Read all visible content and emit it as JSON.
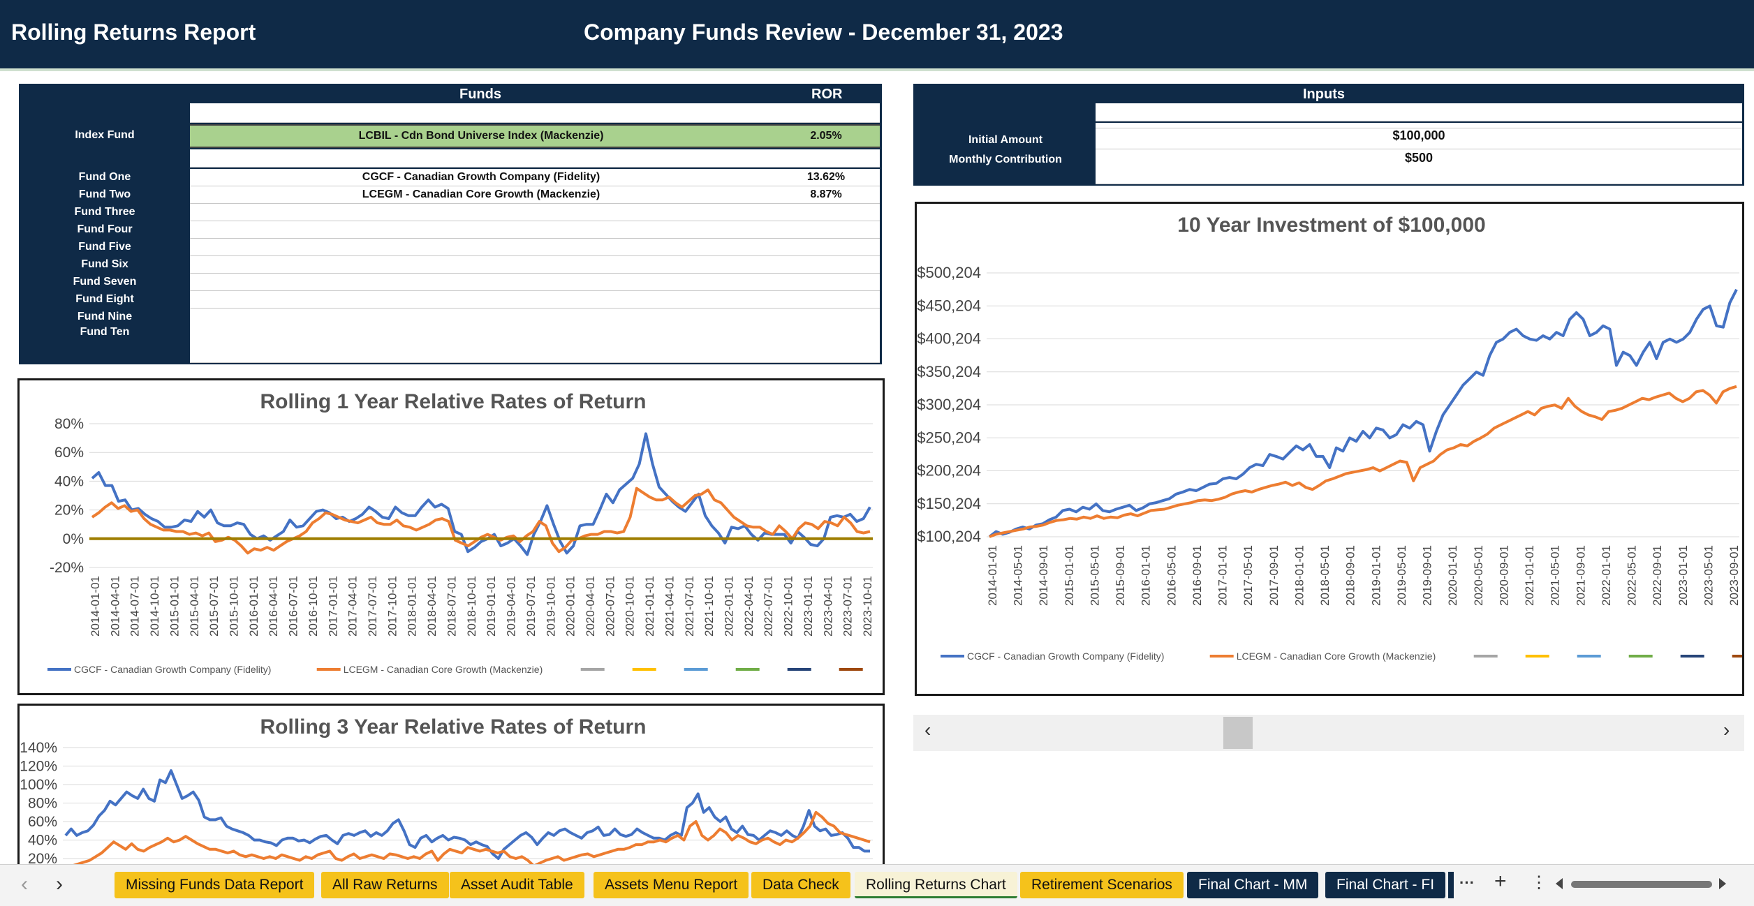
{
  "header": {
    "left_title": "Rolling Returns Report",
    "center_title": "Company Funds Review - December 31, 2023"
  },
  "funds_table": {
    "col_funds": "Funds",
    "col_ror": "ROR",
    "index_label": "Index Fund",
    "index_fund": "LCBIL - Cdn Bond Universe Index (Mackenzie)",
    "index_ror": "2.05%",
    "rows": [
      {
        "label": "Fund One",
        "fund": "CGCF - Canadian Growth Company (Fidelity)",
        "ror": "13.62%"
      },
      {
        "label": "Fund Two",
        "fund": "LCEGM - Canadian Core Growth (Mackenzie)",
        "ror": "8.87%"
      },
      {
        "label": "Fund Three",
        "fund": "",
        "ror": ""
      },
      {
        "label": "Fund Four",
        "fund": "",
        "ror": ""
      },
      {
        "label": "Fund Five",
        "fund": "",
        "ror": ""
      },
      {
        "label": "Fund Six",
        "fund": "",
        "ror": ""
      },
      {
        "label": "Fund Seven",
        "fund": "",
        "ror": ""
      },
      {
        "label": "Fund Eight",
        "fund": "",
        "ror": ""
      },
      {
        "label": "Fund Nine",
        "fund": "",
        "ror": ""
      },
      {
        "label": "Fund Ten",
        "fund": "",
        "ror": ""
      }
    ]
  },
  "inputs": {
    "title": "Inputs",
    "initial_label": "Initial Amount",
    "initial_value": "$100,000",
    "monthly_label": "Monthly Contribution",
    "monthly_value": "$500"
  },
  "colors": {
    "navy": "#0f2a47",
    "fund_one": "#4472c4",
    "fund_two": "#ed7d31",
    "index_green": "#a9d18e",
    "tab_yellow": "#f5c21b"
  },
  "chart_data": [
    {
      "type": "line",
      "title": "Rolling 1 Year Relative Rates of Return",
      "y_ticks": [
        "80%",
        "60%",
        "40%",
        "20%",
        "0%",
        "-20%"
      ],
      "ylim": [
        -20,
        80
      ],
      "x_ticks": [
        "2014-01-01",
        "2014-04-01",
        "2014-07-01",
        "2014-10-01",
        "2015-01-01",
        "2015-04-01",
        "2015-07-01",
        "2015-10-01",
        "2016-01-01",
        "2016-04-01",
        "2016-07-01",
        "2016-10-01",
        "2017-01-01",
        "2017-04-01",
        "2017-07-01",
        "2017-10-01",
        "2018-01-01",
        "2018-04-01",
        "2018-07-01",
        "2018-10-01",
        "2019-01-01",
        "2019-04-01",
        "2019-07-01",
        "2019-10-01",
        "2020-01-01",
        "2020-04-01",
        "2020-07-01",
        "2020-10-01",
        "2021-01-01",
        "2021-04-01",
        "2021-07-01",
        "2021-10-01",
        "2022-01-01",
        "2022-04-01",
        "2022-07-01",
        "2022-10-01",
        "2023-01-01",
        "2023-04-01",
        "2023-07-01",
        "2023-10-01"
      ],
      "legend": [
        "CGCF - Canadian Growth Company (Fidelity)",
        "LCEGM - Canadian Core Growth (Mackenzie)"
      ],
      "series": [
        {
          "name": "CGCF - Canadian Growth Company (Fidelity)",
          "color": "#4472c4",
          "values": [
            42,
            46,
            37,
            37,
            26,
            27,
            20,
            21,
            17,
            14,
            12,
            8,
            8,
            9,
            13,
            12,
            19,
            15,
            20,
            11,
            9,
            9,
            11,
            10,
            3,
            0,
            2,
            -1,
            2,
            5,
            13,
            8,
            9,
            14,
            19,
            20,
            18,
            14,
            15,
            12,
            14,
            17,
            22,
            19,
            15,
            14,
            22,
            18,
            16,
            16,
            22,
            27,
            22,
            24,
            21,
            5,
            3,
            -9,
            -6,
            -2,
            0,
            3,
            -5,
            -3,
            0,
            -5,
            -11,
            3,
            12,
            23,
            10,
            -2,
            -10,
            -5,
            9,
            10,
            10,
            20,
            31,
            25,
            34,
            38,
            42,
            52,
            73,
            52,
            36,
            31,
            26,
            22,
            19,
            25,
            31,
            16,
            9,
            4,
            -3,
            8,
            7,
            9,
            3,
            -1,
            4,
            3,
            3,
            3,
            -3,
            5,
            1,
            -4,
            -5,
            0,
            15,
            16,
            15,
            17,
            12,
            14,
            22
          ]
        },
        {
          "name": "LCEGM - Canadian Core Growth (Mackenzie)",
          "color": "#ed7d31",
          "values": [
            15,
            18,
            22,
            25,
            21,
            23,
            19,
            20,
            14,
            10,
            8,
            6,
            6,
            5,
            5,
            3,
            4,
            2,
            4,
            -2,
            -1,
            1,
            -1,
            -5,
            -10,
            -7,
            -8,
            -6,
            -8,
            -5,
            -2,
            0,
            2,
            5,
            11,
            14,
            18,
            17,
            15,
            13,
            12,
            11,
            13,
            15,
            11,
            10,
            10,
            13,
            9,
            8,
            6,
            8,
            10,
            13,
            14,
            12,
            -1,
            -3,
            -5,
            -2,
            1,
            3,
            1,
            -1,
            1,
            2,
            -2,
            2,
            5,
            12,
            9,
            -3,
            -9,
            -6,
            -1,
            0,
            2,
            3,
            3,
            5,
            5,
            4,
            5,
            15,
            35,
            32,
            29,
            27,
            27,
            29,
            25,
            22,
            26,
            30,
            31,
            34,
            27,
            25,
            20,
            15,
            12,
            9,
            8,
            8,
            5,
            3,
            9,
            5,
            0,
            7,
            11,
            10,
            7,
            12,
            11,
            9,
            15,
            11,
            5,
            4,
            5
          ]
        },
        {
          "name": "",
          "color": "#9e7d00",
          "values": [
            0
          ]
        }
      ]
    },
    {
      "type": "line",
      "title": "10 Year Investment of $100,000",
      "y_ticks": [
        "$500,204",
        "$450,204",
        "$400,204",
        "$350,204",
        "$300,204",
        "$250,204",
        "$200,204",
        "$150,204",
        "$100,204"
      ],
      "ylim": [
        100204,
        500204
      ],
      "x_ticks": [
        "2014-01-01",
        "2014-05-01",
        "2014-09-01",
        "2015-01-01",
        "2015-05-01",
        "2015-09-01",
        "2016-01-01",
        "2016-05-01",
        "2016-09-01",
        "2017-01-01",
        "2017-05-01",
        "2017-09-01",
        "2018-01-01",
        "2018-05-01",
        "2018-09-01",
        "2019-01-01",
        "2019-05-01",
        "2019-09-01",
        "2020-01-01",
        "2020-05-01",
        "2020-09-01",
        "2021-01-01",
        "2021-05-01",
        "2021-09-01",
        "2022-01-01",
        "2022-05-01",
        "2022-09-01",
        "2023-01-01",
        "2023-05-01",
        "2023-09-01"
      ],
      "legend": [
        "CGCF - Canadian Growth Company (Fidelity)",
        "LCEGM - Canadian Core Growth (Mackenzie)"
      ],
      "series": [
        {
          "name": "CGCF - Canadian Growth Company (Fidelity)",
          "color": "#4472c4",
          "values": [
            100204,
            108000,
            104000,
            107000,
            112000,
            115000,
            112000,
            118000,
            120000,
            126000,
            130000,
            140000,
            142000,
            138000,
            145000,
            142000,
            150000,
            140000,
            138000,
            142000,
            145000,
            148000,
            140000,
            144000,
            150000,
            152000,
            155000,
            158000,
            165000,
            168000,
            172000,
            170000,
            175000,
            180000,
            181000,
            188000,
            190000,
            188000,
            195000,
            205000,
            210000,
            208000,
            225000,
            222000,
            218000,
            228000,
            238000,
            232000,
            240000,
            222000,
            222000,
            205000,
            235000,
            230000,
            250000,
            245000,
            260000,
            250000,
            265000,
            262000,
            250000,
            255000,
            270000,
            265000,
            275000,
            270000,
            230000,
            260000,
            285000,
            300000,
            315000,
            330000,
            340000,
            350000,
            345000,
            375000,
            395000,
            400000,
            410000,
            415000,
            405000,
            400000,
            398000,
            405000,
            400000,
            410000,
            405000,
            430000,
            440000,
            430000,
            405000,
            410000,
            420000,
            415000,
            360000,
            380000,
            375000,
            360000,
            380000,
            395000,
            370000,
            395000,
            400000,
            395000,
            400000,
            410000,
            430000,
            445000,
            450000,
            420000,
            418000,
            455000,
            475000
          ]
        },
        {
          "name": "LCEGM - Canadian Core Growth (Mackenzie)",
          "color": "#ed7d31",
          "values": [
            100204,
            104000,
            106000,
            108000,
            110000,
            112000,
            115000,
            116000,
            118000,
            122000,
            125000,
            126000,
            128000,
            127000,
            130000,
            128000,
            132000,
            128000,
            130000,
            129000,
            133000,
            135000,
            132000,
            136000,
            140000,
            141000,
            142000,
            145000,
            148000,
            150000,
            152000,
            155000,
            156000,
            155000,
            157000,
            160000,
            165000,
            168000,
            170000,
            168000,
            172000,
            175000,
            178000,
            180000,
            183000,
            178000,
            182000,
            175000,
            172000,
            178000,
            185000,
            188000,
            192000,
            196000,
            198000,
            200000,
            202000,
            205000,
            200000,
            205000,
            210000,
            215000,
            213000,
            185000,
            205000,
            210000,
            215000,
            225000,
            232000,
            235000,
            240000,
            238000,
            245000,
            250000,
            256000,
            265000,
            270000,
            275000,
            280000,
            285000,
            290000,
            285000,
            295000,
            298000,
            300000,
            295000,
            310000,
            298000,
            290000,
            285000,
            282000,
            278000,
            290000,
            292000,
            295000,
            300000,
            305000,
            310000,
            308000,
            312000,
            315000,
            318000,
            310000,
            305000,
            310000,
            320000,
            322000,
            315000,
            303000,
            320000,
            325000,
            328000
          ]
        }
      ]
    },
    {
      "type": "line",
      "title": "Rolling 3 Year Relative Rates of Return",
      "y_ticks": [
        "140%",
        "120%",
        "100%",
        "80%",
        "60%",
        "40%",
        "20%"
      ],
      "ylim": [
        20,
        140
      ],
      "series": [
        {
          "name": "CGCF - Canadian Growth Company (Fidelity)",
          "color": "#4472c4",
          "values": [
            45,
            52,
            45,
            48,
            50,
            56,
            66,
            72,
            82,
            78,
            85,
            92,
            88,
            85,
            95,
            85,
            82,
            105,
            102,
            115,
            100,
            85,
            88,
            92,
            83,
            65,
            62,
            62,
            64,
            55,
            52,
            50,
            48,
            45,
            40,
            40,
            38,
            37,
            34,
            40,
            42,
            42,
            39,
            40,
            37,
            41,
            44,
            45,
            40,
            36,
            45,
            47,
            45,
            48,
            50,
            44,
            48,
            45,
            50,
            58,
            62,
            50,
            35,
            32,
            42,
            45,
            38,
            42,
            45,
            40,
            43,
            42,
            40,
            35,
            38,
            35,
            33,
            25,
            20,
            30,
            35,
            40,
            45,
            48,
            43,
            35,
            42,
            48,
            45,
            50,
            52,
            48,
            45,
            42,
            48,
            50,
            54,
            45,
            46,
            52,
            46,
            44,
            46,
            52,
            48,
            45,
            42,
            42,
            40,
            45,
            48,
            45,
            75,
            80,
            90,
            70,
            75,
            65,
            60,
            65,
            52,
            48,
            55,
            46,
            45,
            40,
            45,
            50,
            48,
            45,
            50,
            45,
            42,
            55,
            72,
            55,
            50,
            52,
            45,
            46,
            48,
            42,
            32,
            32,
            28,
            28
          ]
        },
        {
          "name": "LCEGM - Canadian Core Growth (Mackenzie)",
          "color": "#ed7d31",
          "values": [
            10,
            12,
            14,
            16,
            18,
            22,
            26,
            32,
            38,
            34,
            30,
            36,
            30,
            28,
            32,
            35,
            38,
            42,
            38,
            40,
            44,
            40,
            36,
            33,
            30,
            30,
            28,
            26,
            28,
            24,
            22,
            24,
            22,
            20,
            22,
            20,
            24,
            22,
            20,
            18,
            22,
            20,
            24,
            26,
            28,
            20,
            18,
            22,
            25,
            20,
            22,
            24,
            22,
            20,
            25,
            24,
            22,
            20,
            22,
            20,
            25,
            28,
            18,
            25,
            30,
            28,
            26,
            32,
            30,
            28,
            30,
            28,
            26,
            28,
            22,
            20,
            22,
            18,
            12,
            15,
            18,
            20,
            22,
            18,
            20,
            22,
            24,
            25,
            22,
            24,
            26,
            28,
            30,
            30,
            32,
            35,
            35,
            38,
            38,
            40,
            38,
            42,
            45,
            40,
            55,
            60,
            45,
            40,
            45,
            52,
            48,
            40,
            45,
            42,
            38,
            36,
            40,
            42,
            38,
            35,
            40,
            38,
            42,
            48,
            55,
            70,
            65,
            58,
            55,
            48,
            46,
            44,
            42,
            40,
            38
          ]
        }
      ]
    }
  ],
  "scrollbar": {
    "left_arrow": "‹",
    "right_arrow": "›"
  },
  "tabs": [
    {
      "label": "Missing Funds Data Report",
      "style": "yellow"
    },
    {
      "label": "All Raw Returns",
      "style": "yellow"
    },
    {
      "label": "Asset Audit Table",
      "style": "yellow"
    },
    {
      "label": "Assets Menu Report",
      "style": "yellow"
    },
    {
      "label": "Data Check",
      "style": "yellow"
    },
    {
      "label": "Rolling Returns Chart",
      "style": "active"
    },
    {
      "label": "Retirement Scenarios",
      "style": "yellow"
    },
    {
      "label": "Final Chart - MM",
      "style": "navy"
    },
    {
      "label": "Final Chart - FI",
      "style": "navy"
    }
  ],
  "tabbar": {
    "prev": "‹",
    "next": "›",
    "more": "···",
    "add": "+",
    "options": "⋮"
  }
}
